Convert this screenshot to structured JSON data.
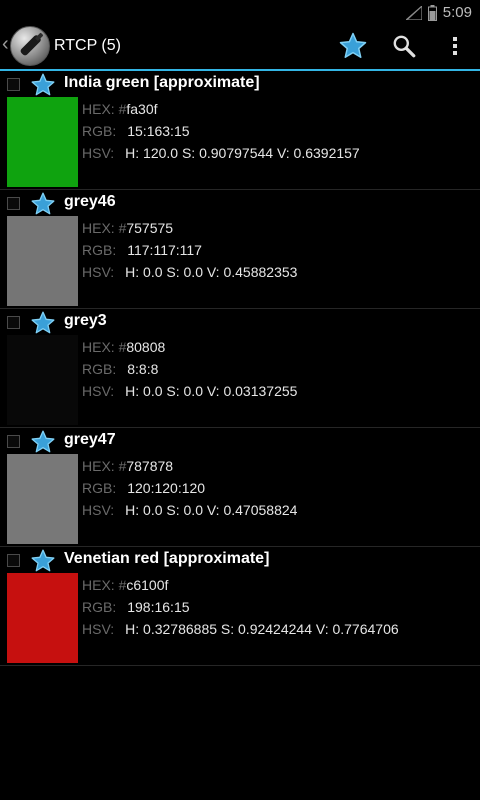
{
  "status_bar": {
    "time": "5:09",
    "icons": [
      "signal-icon",
      "battery-icon"
    ]
  },
  "action_bar": {
    "title": "RTCP (5)",
    "icons": [
      "up-caret-icon",
      "app-logo",
      "star-icon",
      "search-icon",
      "overflow-menu-icon"
    ],
    "accent_color": "#33b5e5"
  },
  "labels": {
    "hex": "HEX: #",
    "rgb": "RGB:",
    "hsv": "HSV:"
  },
  "colors": [
    {
      "name": "India green [approximate]",
      "hex": "fa30f",
      "rgb": "15:163:15",
      "hsv": "H: 120.0 S: 0.90797544 V: 0.6392157",
      "swatch": "#0fa30f"
    },
    {
      "name": "grey46",
      "hex": "757575",
      "rgb": "117:117:117",
      "hsv": "H: 0.0 S: 0.0 V: 0.45882353",
      "swatch": "#757575"
    },
    {
      "name": "grey3",
      "hex": "80808",
      "rgb": "8:8:8",
      "hsv": "H: 0.0 S: 0.0 V: 0.03137255",
      "swatch": "#080808"
    },
    {
      "name": "grey47",
      "hex": "787878",
      "rgb": "120:120:120",
      "hsv": "H: 0.0 S: 0.0 V: 0.47058824",
      "swatch": "#787878"
    },
    {
      "name": "Venetian red [approximate]",
      "hex": "c6100f",
      "rgb": "198:16:15",
      "hsv": "H: 0.32786885 S: 0.92424244 V: 0.7764706",
      "swatch": "#c6100f"
    }
  ]
}
